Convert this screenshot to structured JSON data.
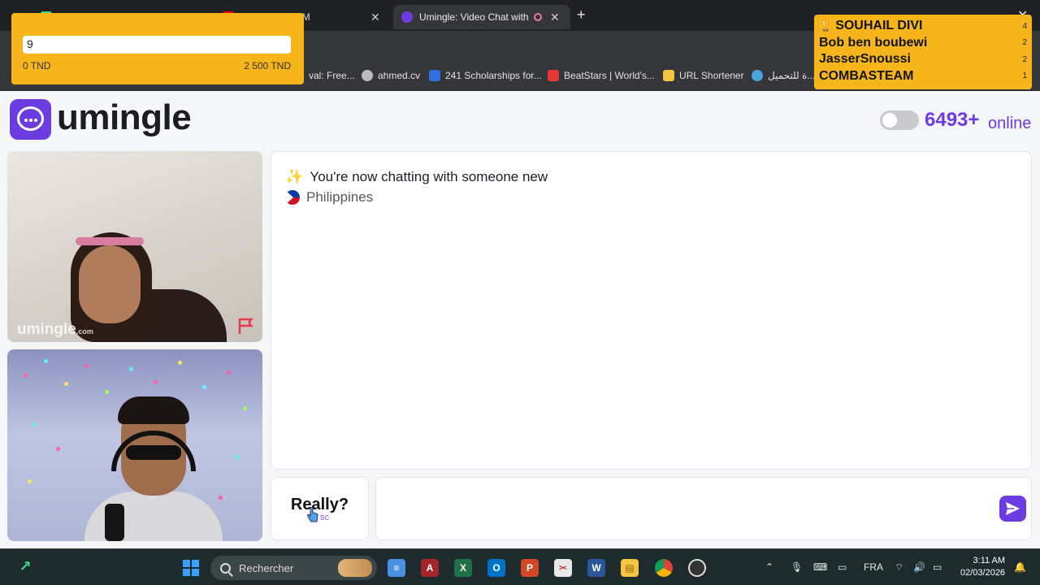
{
  "browser": {
    "tabs": [
      {
        "label": "",
        "color": "#3ddc84"
      },
      {
        "label": "Glory (Official M",
        "color": "#ff0000"
      },
      {
        "label": "Umingle: Video Chat with S",
        "color": "#6c3ce1",
        "active": true
      }
    ],
    "bookmarks": [
      {
        "label": "val: Free...",
        "color": "#888"
      },
      {
        "label": "ahmed.cv",
        "color": "#bbb"
      },
      {
        "label": "241 Scholarships for...",
        "color": "#2f6fde"
      },
      {
        "label": "BeatStars | World's...",
        "color": "#e53935"
      },
      {
        "label": "URL Shortener",
        "color": "#f4c542"
      },
      {
        "label": "ة للتحميل...",
        "color": "#4aa3df"
      }
    ]
  },
  "donation": {
    "input_value": "9",
    "min_label": "0 TND",
    "max_label": "2 500 TND"
  },
  "leaderboard": [
    {
      "name": "SOUHAIL DIVI",
      "count": "4",
      "top": true
    },
    {
      "name": "Bob ben boubewi",
      "count": "2"
    },
    {
      "name": "JasserSnoussi",
      "count": "2"
    },
    {
      "name": "COMBASTEAM",
      "count": "1"
    }
  ],
  "site": {
    "logo_text": "umingle",
    "online_count": "6493+",
    "online_label": "online",
    "accent": "#6c3ce1"
  },
  "video": {
    "watermark": "umingle",
    "watermark_suffix": ".com"
  },
  "chat": {
    "system_message": "You're now chatting with someone new",
    "country": "Philippines"
  },
  "controls": {
    "skip_label": "Really?",
    "skip_hint": "sc",
    "message_placeholder": ""
  },
  "taskbar": {
    "search_label": "Rechercher",
    "language": "FRA",
    "time": "3:11 AM",
    "date": "02/03/2026"
  }
}
